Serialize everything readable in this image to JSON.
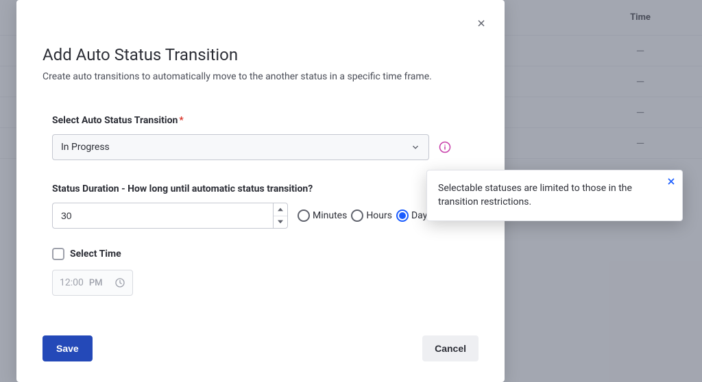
{
  "background": {
    "header_time": "Time",
    "row_placeholder": "—"
  },
  "modal": {
    "title": "Add Auto Status Transition",
    "subtitle": "Create auto transitions to automatically move to the another status in a specific time frame.",
    "select_label": "Select Auto Status Transition",
    "select_value": "In Progress",
    "duration_label": "Status Duration - How long until automatic status transition?",
    "duration_value": "30",
    "radio_minutes": "Minutes",
    "radio_hours": "Hours",
    "radio_days": "Days",
    "select_time_label": "Select Time",
    "time_value": "12:00",
    "time_ampm": "PM",
    "save_label": "Save",
    "cancel_label": "Cancel"
  },
  "tooltip": {
    "text": "Selectable statuses are limited to those in the transition restrictions."
  }
}
